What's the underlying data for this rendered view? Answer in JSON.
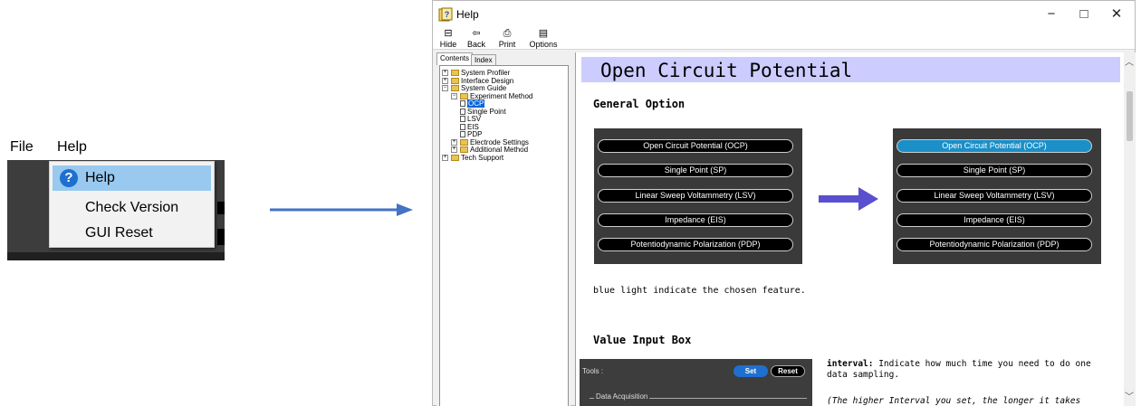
{
  "menu": {
    "bar": {
      "file": "File",
      "help": "Help"
    },
    "items": [
      {
        "label": "Help",
        "selected": true,
        "icon": "help-question-icon"
      },
      {
        "label": "Check Version",
        "selected": false
      },
      {
        "label": "GUI Reset",
        "selected": false
      }
    ]
  },
  "window": {
    "title": "Help",
    "controls": {
      "minimize": "−",
      "maximize": "□",
      "close": "✕"
    },
    "toolbar": {
      "hide": "Hide",
      "back": "Back",
      "print": "Print",
      "options": "Options"
    },
    "tabs": {
      "contents": "Contents",
      "index": "Index"
    },
    "tree": [
      {
        "label": "System Profiler",
        "level": 0,
        "type": "folder",
        "toggle": "+"
      },
      {
        "label": "Interface Design",
        "level": 0,
        "type": "folder",
        "toggle": "+"
      },
      {
        "label": "System Guide",
        "level": 0,
        "type": "folder",
        "toggle": "−"
      },
      {
        "label": "Experiment Method",
        "level": 1,
        "type": "folder",
        "toggle": "−"
      },
      {
        "label": "OCP",
        "level": 2,
        "type": "page",
        "selected": true
      },
      {
        "label": "Single Point",
        "level": 2,
        "type": "page"
      },
      {
        "label": "LSV",
        "level": 2,
        "type": "page"
      },
      {
        "label": "EIS",
        "level": 2,
        "type": "page"
      },
      {
        "label": "PDP",
        "level": 2,
        "type": "page"
      },
      {
        "label": "Electrode Settings",
        "level": 1,
        "type": "folder",
        "toggle": "+"
      },
      {
        "label": "Additional Method",
        "level": 1,
        "type": "folder",
        "toggle": "+"
      },
      {
        "label": "Tech Support",
        "level": 0,
        "type": "folder",
        "toggle": "+"
      }
    ]
  },
  "content": {
    "heading": "Open Circuit Potential",
    "section_general": "General Option",
    "methods": [
      "Open Circuit Potential (OCP)",
      "Single Point (SP)",
      "Linear Sweep Voltammetry (LSV)",
      "Impedance (EIS)",
      "Potentiodynamic Polarization (PDP)"
    ],
    "note": "blue light indicate the chosen feature.",
    "section_value": "Value Input Box",
    "tools": {
      "label": "Tools :",
      "set": "Set",
      "reset": "Reset",
      "group": "Data Acquisition"
    },
    "interval_term": "interval:",
    "interval_desc": " Indicate how much time you need to do one data sampling.",
    "interval_note": "(The higher Interval you set, the longer it takes"
  },
  "colors": {
    "menu_highlight": "#99c9ef",
    "heading_bg": "#ccccff",
    "active_method": "#1a8fc8",
    "arrow": "#4472c4",
    "mid_arrow": "#5a4fcf"
  }
}
